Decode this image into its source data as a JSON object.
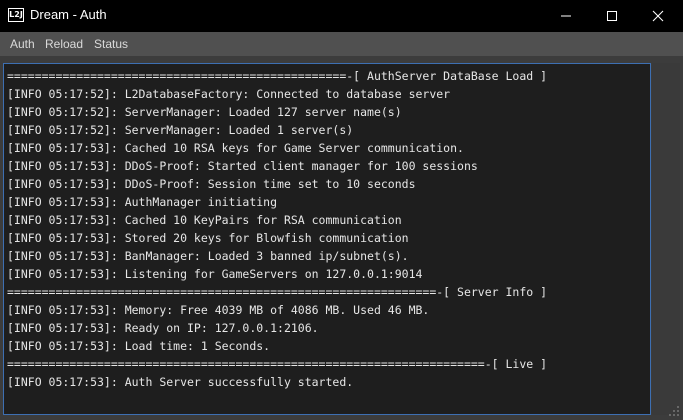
{
  "window": {
    "title": "Dream - Auth",
    "icon_label": "L2J"
  },
  "menu": {
    "items": [
      {
        "label": "Auth"
      },
      {
        "label": "Reload"
      },
      {
        "label": "Status"
      }
    ]
  },
  "console": {
    "lines": [
      "=================================================-[ AuthServer DataBase Load ]",
      "[INFO 05:17:52]: L2DatabaseFactory: Connected to database server",
      "[INFO 05:17:52]: ServerManager: Loaded 127 server name(s)",
      "[INFO 05:17:52]: ServerManager: Loaded 1 server(s)",
      "[INFO 05:17:53]: Cached 10 RSA keys for Game Server communication.",
      "[INFO 05:17:53]: DDoS-Proof: Started client manager for 100 sessions",
      "[INFO 05:17:53]: DDoS-Proof: Session time set to 10 seconds",
      "[INFO 05:17:53]: AuthManager initiating",
      "[INFO 05:17:53]: Cached 10 KeyPairs for RSA communication",
      "[INFO 05:17:53]: Stored 20 keys for Blowfish communication",
      "[INFO 05:17:53]: BanManager: Loaded 3 banned ip/subnet(s).",
      "[INFO 05:17:53]: Listening for GameServers on 127.0.0.1:9014",
      "==============================================================-[ Server Info ]",
      "[INFO 05:17:53]: Memory: Free 4039 MB of 4086 MB. Used 46 MB.",
      "[INFO 05:17:53]: Ready on IP: 127.0.0.1:2106.",
      "[INFO 05:17:53]: Load time: 1 Seconds.",
      "=====================================================================-[ Live ]",
      "[INFO 05:17:53]: Auth Server successfully started."
    ]
  },
  "colors": {
    "titlebar": "#000000",
    "menubar": "#505050",
    "console_bg": "#1e1e1e",
    "console_text": "#e6e6e6",
    "console_border": "#3d6fb2"
  },
  "icons": {
    "minimize": "minimize-icon",
    "maximize": "maximize-icon",
    "close": "close-icon"
  }
}
